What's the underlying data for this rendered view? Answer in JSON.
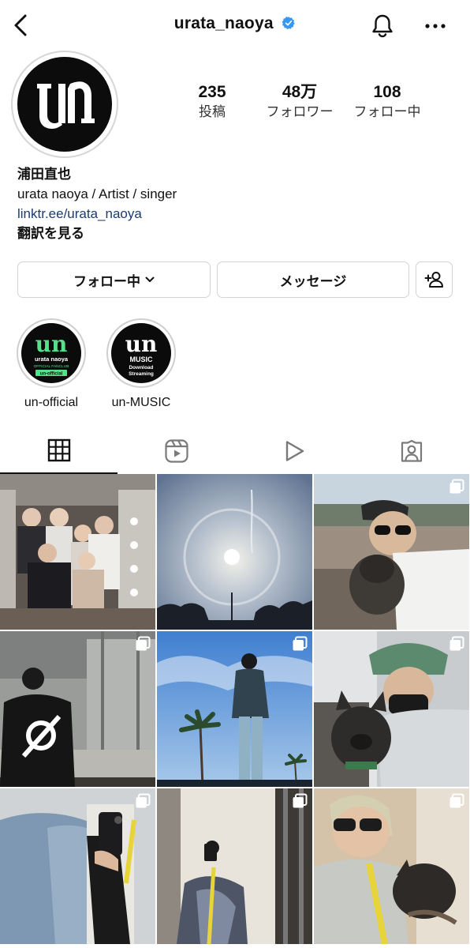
{
  "header": {
    "username": "urata_naoya"
  },
  "stats": [
    {
      "value": "235",
      "label": "投稿"
    },
    {
      "value": "48万",
      "label": "フォロワー"
    },
    {
      "value": "108",
      "label": "フォロー中"
    }
  ],
  "bio": {
    "name": "浦田直也",
    "tagline": "urata naoya / Artist / singer",
    "link": "linktr.ee/urata_naoya",
    "translate": "翻訳を見る"
  },
  "actions": {
    "follow_label": "フォロー中",
    "message_label": "メッセージ"
  },
  "highlights": [
    {
      "label": "un-official",
      "logo": "un",
      "lines": [
        "urata naoya",
        "OFFICIAL FANCLUB",
        "un-official"
      ],
      "accent": "#56e08a"
    },
    {
      "label": "un-MUSIC",
      "logo": "un",
      "lines": [
        "MUSIC",
        "Download",
        "Streaming"
      ],
      "accent": "#ffffff"
    }
  ],
  "avatar": {
    "logo": "un"
  },
  "tabs": [
    "grid-icon",
    "reels-icon",
    "video-icon",
    "tagged-icon"
  ],
  "posts": [
    {
      "subject": "group-photo-in-dressing-room",
      "multi": false
    },
    {
      "subject": "sun-halo-sky",
      "multi": false
    },
    {
      "subject": "man-with-sunglasses-and-dog",
      "multi": true
    },
    {
      "subject": "black-hoodie-back-in-garage",
      "multi": true
    },
    {
      "subject": "man-on-sky-with-palm-trees",
      "multi": true
    },
    {
      "subject": "man-with-french-bulldog",
      "multi": true
    },
    {
      "subject": "mirror-selfie-denim-jacket",
      "multi": true
    },
    {
      "subject": "mirror-selfie-in-hallway",
      "multi": true
    },
    {
      "subject": "man-sunglasses-with-dog-couch",
      "multi": true
    }
  ],
  "colors": {
    "link": "#1c3b6f",
    "verified": "#3897f0",
    "tab_active": "#111111",
    "tab_inactive": "#9a9a9a"
  }
}
